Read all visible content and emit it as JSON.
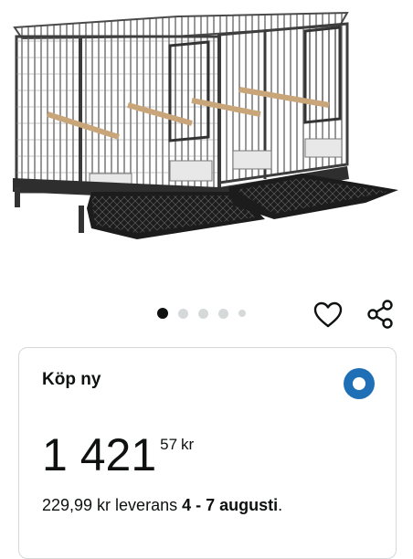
{
  "carousel": {
    "slides": 5,
    "active_index": 0
  },
  "buy_box": {
    "title": "Köp ny",
    "price_whole": "1 421",
    "price_fraction": "57",
    "price_currency": "kr",
    "delivery_prefix": "229,99 kr leverans ",
    "delivery_dates": "4 - 7 augusti",
    "delivery_suffix": "."
  },
  "colors": {
    "radio_selected": "#1f6fb7",
    "text": "#0f1111",
    "dot_inactive": "#d5d9d9"
  },
  "icons": [
    "heart-icon",
    "share-icon",
    "radio-selected-icon"
  ]
}
